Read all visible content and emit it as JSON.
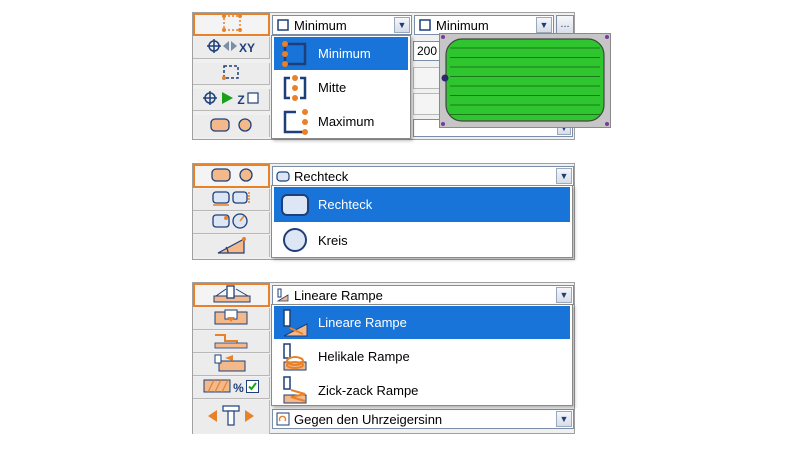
{
  "panel1": {
    "combo_left": {
      "value": "Minimum"
    },
    "combo_right": {
      "value": "Minimum",
      "more_label": "..."
    },
    "row2_value": "200",
    "xy_label": "XY",
    "z_label": "Z",
    "dropdown": [
      {
        "label": "Minimum",
        "selected": true
      },
      {
        "label": "Mitte",
        "selected": false
      },
      {
        "label": "Maximum",
        "selected": false
      }
    ],
    "preview": {
      "fill": "#2fc52f",
      "line": "#1a7a1a",
      "corner": "#7a3aa0"
    }
  },
  "panel2": {
    "combo": {
      "value": "Rechteck"
    },
    "dropdown": [
      {
        "label": "Rechteck",
        "selected": true
      },
      {
        "label": "Kreis",
        "selected": false
      }
    ]
  },
  "panel3": {
    "combo": {
      "value": "Lineare Rampe"
    },
    "combo_bottom": {
      "value": "Gegen den Uhrzeigersinn"
    },
    "percent_label": "%",
    "dropdown": [
      {
        "label": "Lineare Rampe",
        "selected": true
      },
      {
        "label": "Helikale Rampe",
        "selected": false
      },
      {
        "label": "Zick-zack Rampe",
        "selected": false
      }
    ]
  },
  "colors": {
    "accent": "#e8822a",
    "brand_blue": "#1e3f7a",
    "selection": "#1874d8",
    "green": "#1aa01a"
  }
}
